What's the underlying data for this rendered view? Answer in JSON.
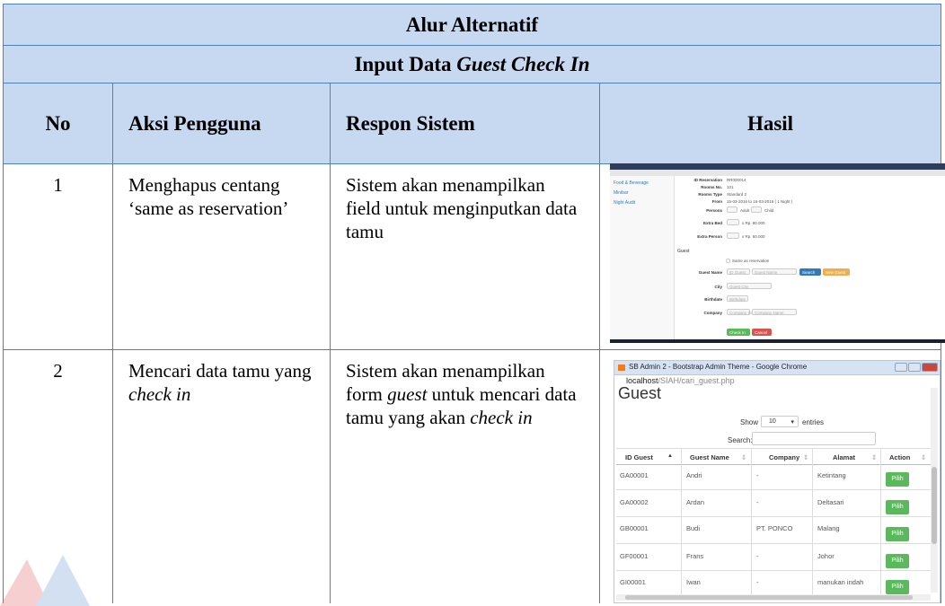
{
  "title": "Alur Alternatif",
  "subtitle_plain": "Input Data ",
  "subtitle_italic": "Guest Check In",
  "columns": [
    "No",
    "Aksi Pengguna",
    "Respon Sistem",
    "Hasil"
  ],
  "rows": [
    {
      "no": "1",
      "aksi": "Menghapus centang ‘same as reservation’",
      "respon": "Sistem akan menampilkan field untuk menginputkan data tamu"
    },
    {
      "no": "2",
      "aksi_plain": "Mencari data tamu yang ",
      "aksi_italic": "check in",
      "respon_1": "Sistem akan menampilkan form ",
      "respon_2": "guest",
      "respon_3": " untuk mencari data tamu yang akan ",
      "respon_4": "check in"
    }
  ],
  "shot1": {
    "side_items": [
      "Food & Beverage",
      "Minibar",
      "Night Audit"
    ],
    "labels": [
      "ID Reservation",
      "Rooms No.",
      "Rooms Type",
      "From",
      "Persons",
      "Extra Bed",
      "Extra Person",
      "Guest",
      "Guest Name",
      "City",
      "Birthdate",
      "Company"
    ],
    "values": [
      "RR000014",
      "101",
      "Standard 2",
      "15-03-2016 to 16-03-2016 ( 1 Night )",
      "Adult",
      "Child",
      "x Rp. 80.000",
      "x Rp. 50.000",
      "Same as reservation",
      "ID Guest",
      "Guest Name",
      "Guest City",
      "Birthdate",
      "Company ID",
      "Company Name"
    ],
    "buttons": [
      "Search",
      "New Guest",
      "Check In",
      "Cancel"
    ]
  },
  "shot2": {
    "window_title": "SB Admin 2 - Bootstrap Admin Theme - Google Chrome",
    "url_host": "localhost",
    "url_path": "/SIAH/cari_guest.php",
    "page_title": "Guest",
    "show_label": "Show",
    "entries_value": "10",
    "entries_label": "entries",
    "search_label": "Search:",
    "headers": [
      "ID Guest",
      "Guest Name",
      "Company",
      "Alamat",
      "Action"
    ],
    "rows": [
      {
        "id": "GA00001",
        "name": "Andri",
        "company": "-",
        "alamat": "Ketintang"
      },
      {
        "id": "GA00002",
        "name": "Ardan",
        "company": "-",
        "alamat": "Deltasari"
      },
      {
        "id": "GB00001",
        "name": "Budi",
        "company": "PT. PONCO",
        "alamat": "Malang"
      },
      {
        "id": "GF00001",
        "name": "Frans",
        "company": "-",
        "alamat": "Johor"
      },
      {
        "id": "GI00001",
        "name": "Iwan",
        "company": "-",
        "alamat": "manukan indah"
      }
    ],
    "action_label": "Pilih"
  },
  "colors": {
    "header_bg": "#c6d9f1",
    "border": "#4f81bd",
    "btn_green": "#5cb85c",
    "btn_blue": "#337ab7",
    "btn_orange": "#f0ad4e",
    "btn_red": "#d9534f"
  }
}
